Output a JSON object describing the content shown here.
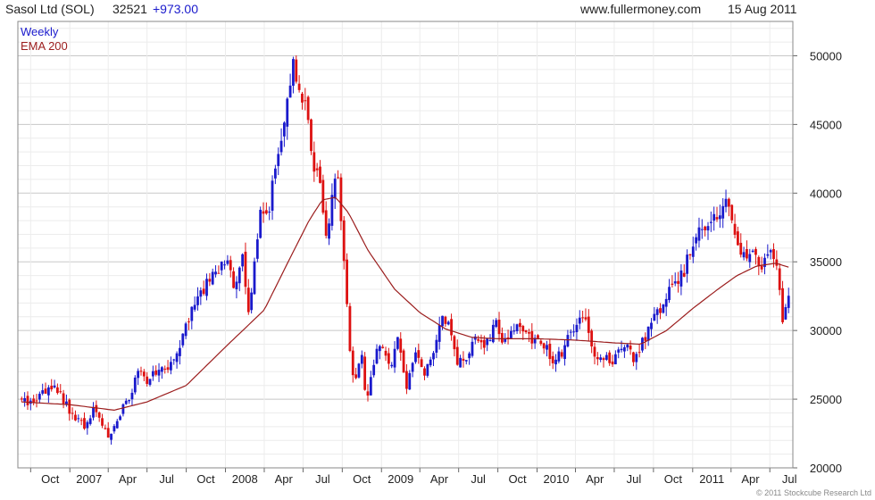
{
  "header": {
    "instrument": "Sasol Ltd (SOL)",
    "last": "32521",
    "change": "+973.00",
    "site": "www.fullermoney.com",
    "date": "15 Aug 2011"
  },
  "footer": {
    "copyright": "© 2011 Stockcube Research Ltd"
  },
  "colors": {
    "up": "#1a1acc",
    "down": "#dd1111",
    "ema": "#9b1d1d",
    "grid": "#dcdcdc",
    "change": "#1a1acc",
    "legend_weekly": "#1a1acc",
    "legend_ema": "#9b1d1d"
  },
  "chart_data": {
    "type": "candlestick",
    "title": "Sasol Ltd (SOL)",
    "legend": [
      "Weekly",
      "EMA 200"
    ],
    "legend_position": "top-left",
    "x_ticks": [
      "Oct",
      "2007",
      "Apr",
      "Jul",
      "Oct",
      "2008",
      "Apr",
      "Jul",
      "Oct",
      "2009",
      "Apr",
      "Jul",
      "Oct",
      "2010",
      "Apr",
      "Jul",
      "Oct",
      "2011",
      "Apr",
      "Jul"
    ],
    "x_start": "2006-09",
    "x_end": "2011-08",
    "ylim": [
      20000,
      52500
    ],
    "y_ticks": [
      20000,
      25000,
      30000,
      35000,
      40000,
      45000,
      50000
    ],
    "y_axis_side": "right",
    "grid": true,
    "series": [
      {
        "name": "Weekly",
        "kind": "weekly candles",
        "anchors": [
          [
            "2006-09-10",
            25000
          ],
          [
            "2006-10-01",
            24700
          ],
          [
            "2006-11-01",
            25800
          ],
          [
            "2006-12-01",
            25600
          ],
          [
            "2007-01-01",
            24200
          ],
          [
            "2007-02-01",
            23000
          ],
          [
            "2007-03-01",
            24300
          ],
          [
            "2007-04-01",
            22300
          ],
          [
            "2007-04-20",
            23500
          ],
          [
            "2007-05-15",
            24800
          ],
          [
            "2007-06-10",
            26800
          ],
          [
            "2007-07-01",
            26500
          ],
          [
            "2007-08-01",
            27000
          ],
          [
            "2007-09-01",
            27800
          ],
          [
            "2007-10-01",
            30500
          ],
          [
            "2007-11-01",
            32300
          ],
          [
            "2007-12-01",
            34000
          ],
          [
            "2008-01-01",
            35000
          ],
          [
            "2008-01-25",
            33000
          ],
          [
            "2008-02-10",
            35800
          ],
          [
            "2008-02-25",
            31000
          ],
          [
            "2008-03-10",
            35500
          ],
          [
            "2008-03-25",
            39000
          ],
          [
            "2008-04-10",
            38500
          ],
          [
            "2008-05-01",
            42500
          ],
          [
            "2008-05-20",
            45500
          ],
          [
            "2008-06-01",
            48000
          ],
          [
            "2008-06-10",
            49500
          ],
          [
            "2008-06-25",
            47000
          ],
          [
            "2008-07-10",
            46500
          ],
          [
            "2008-07-25",
            42000
          ],
          [
            "2008-08-10",
            41000
          ],
          [
            "2008-08-25",
            37000
          ],
          [
            "2008-09-10",
            40500
          ],
          [
            "2008-09-20",
            42000
          ],
          [
            "2008-09-30",
            36500
          ],
          [
            "2008-10-10",
            33500
          ],
          [
            "2008-10-20",
            27500
          ],
          [
            "2008-11-01",
            26500
          ],
          [
            "2008-11-15",
            28500
          ],
          [
            "2008-11-25",
            24500
          ],
          [
            "2008-12-10",
            27500
          ],
          [
            "2009-01-01",
            29000
          ],
          [
            "2009-01-20",
            27000
          ],
          [
            "2009-02-10",
            29500
          ],
          [
            "2009-03-01",
            26000
          ],
          [
            "2009-03-20",
            28500
          ],
          [
            "2009-04-10",
            27000
          ],
          [
            "2009-05-01",
            28000
          ],
          [
            "2009-05-20",
            30800
          ],
          [
            "2009-06-10",
            30200
          ],
          [
            "2009-07-01",
            27500
          ],
          [
            "2009-07-20",
            28200
          ],
          [
            "2009-08-10",
            29500
          ],
          [
            "2009-09-01",
            28800
          ],
          [
            "2009-09-25",
            30500
          ],
          [
            "2009-10-15",
            29000
          ],
          [
            "2009-11-10",
            30500
          ],
          [
            "2009-12-10",
            29600
          ],
          [
            "2010-01-10",
            29200
          ],
          [
            "2010-02-10",
            27800
          ],
          [
            "2010-03-01",
            28500
          ],
          [
            "2010-04-01",
            30300
          ],
          [
            "2010-04-25",
            30800
          ],
          [
            "2010-05-15",
            28000
          ],
          [
            "2010-06-10",
            28200
          ],
          [
            "2010-07-01",
            27800
          ],
          [
            "2010-07-25",
            29000
          ],
          [
            "2010-08-20",
            27800
          ],
          [
            "2010-09-10",
            29500
          ],
          [
            "2010-10-01",
            31000
          ],
          [
            "2010-10-25",
            32000
          ],
          [
            "2010-11-15",
            33500
          ],
          [
            "2010-12-10",
            34000
          ],
          [
            "2011-01-01",
            36500
          ],
          [
            "2011-01-20",
            37500
          ],
          [
            "2011-02-10",
            38000
          ],
          [
            "2011-03-01",
            38500
          ],
          [
            "2011-03-25",
            39500
          ],
          [
            "2011-04-10",
            37000
          ],
          [
            "2011-05-01",
            35300
          ],
          [
            "2011-05-20",
            35800
          ],
          [
            "2011-06-10",
            34700
          ],
          [
            "2011-07-01",
            35700
          ],
          [
            "2011-07-20",
            34200
          ],
          [
            "2011-08-01",
            30600
          ],
          [
            "2011-08-10",
            31800
          ],
          [
            "2011-08-15",
            32521
          ]
        ]
      },
      {
        "name": "EMA 200",
        "kind": "line",
        "points": [
          [
            "2006-09-10",
            24800
          ],
          [
            "2007-01-01",
            24600
          ],
          [
            "2007-04-15",
            24200
          ],
          [
            "2007-07-01",
            24800
          ],
          [
            "2007-10-01",
            26000
          ],
          [
            "2008-01-01",
            28800
          ],
          [
            "2008-04-01",
            31500
          ],
          [
            "2008-06-01",
            35300
          ],
          [
            "2008-07-15",
            38000
          ],
          [
            "2008-08-15",
            39500
          ],
          [
            "2008-09-15",
            39700
          ],
          [
            "2008-10-15",
            38600
          ],
          [
            "2008-12-01",
            35800
          ],
          [
            "2009-02-01",
            33000
          ],
          [
            "2009-04-01",
            31300
          ],
          [
            "2009-06-01",
            30100
          ],
          [
            "2009-08-01",
            29500
          ],
          [
            "2009-10-01",
            29400
          ],
          [
            "2010-01-01",
            29400
          ],
          [
            "2010-04-01",
            29300
          ],
          [
            "2010-07-01",
            29100
          ],
          [
            "2010-09-01",
            29000
          ],
          [
            "2010-11-01",
            30000
          ],
          [
            "2011-01-01",
            31600
          ],
          [
            "2011-03-01",
            33000
          ],
          [
            "2011-04-15",
            34000
          ],
          [
            "2011-06-01",
            34700
          ],
          [
            "2011-07-15",
            34900
          ],
          [
            "2011-08-15",
            34600
          ]
        ]
      }
    ]
  }
}
